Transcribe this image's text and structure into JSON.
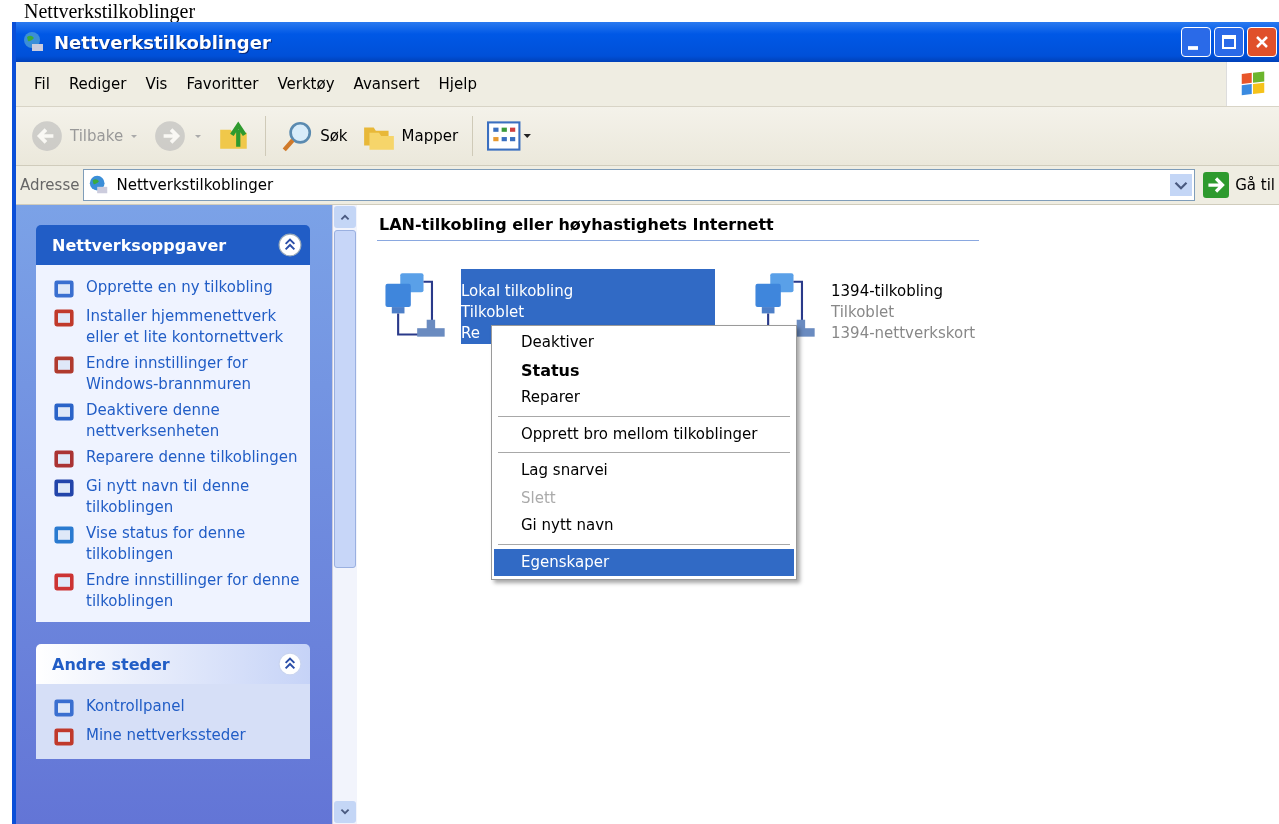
{
  "caption": "Nettverkstilkoblinger",
  "window": {
    "title": "Nettverkstilkoblinger"
  },
  "menu_bar": [
    "Fil",
    "Rediger",
    "Vis",
    "Favoritter",
    "Verktøy",
    "Avansert",
    "Hjelp"
  ],
  "toolbar": [
    {
      "kind": "back",
      "label": "Tilbake",
      "disabled": true
    },
    {
      "kind": "forward",
      "disabled": true
    },
    {
      "kind": "up",
      "disabled": false
    },
    {
      "kind": "search",
      "label": "Søk",
      "disabled": false
    },
    {
      "kind": "folders",
      "label": "Mapper",
      "disabled": false
    },
    {
      "kind": "views",
      "disabled": false
    }
  ],
  "address_bar": {
    "label": "Adresse",
    "value": "Nettverkstilkoblinger",
    "go_label": "Gå til"
  },
  "sidebar": {
    "sections": [
      {
        "title": "Nettverksoppgaver",
        "kind": "special",
        "expanded": true,
        "items": [
          "Opprette en ny tilkobling",
          "Installer hjemmenettverk eller et lite kontornettverk",
          "Endre innstillinger for Windows-brannmuren",
          "Deaktivere denne nettverksenheten",
          "Reparere denne tilkoblingen",
          "Gi nytt navn til denne tilkoblingen",
          "Vise status for denne tilkoblingen",
          "Endre innstillinger for denne tilkoblingen"
        ]
      },
      {
        "title": "Andre steder",
        "kind": "normal",
        "expanded": true,
        "items": [
          "Kontrollpanel",
          "Mine nettverkssteder"
        ]
      }
    ]
  },
  "group": {
    "title": "LAN-tilkobling eller høyhastighets Internett",
    "connections": [
      {
        "name": "Lokal tilkobling",
        "status": "Tilkoblet",
        "device": "Re",
        "selected": true
      },
      {
        "name": "1394-tilkobling",
        "status": "Tilkoblet",
        "device": "1394-nettverkskort",
        "selected": false
      }
    ]
  },
  "context_menu": {
    "groups": [
      {
        "items": [
          {
            "label": "Deaktiver",
            "default": false,
            "disabled": false,
            "selected": false
          },
          {
            "label": "Status",
            "default": true,
            "disabled": false,
            "selected": false
          },
          {
            "label": "Reparer",
            "default": false,
            "disabled": false,
            "selected": false
          }
        ]
      },
      {
        "items": [
          {
            "label": "Opprett bro mellom tilkoblinger",
            "default": false,
            "disabled": false,
            "selected": false
          }
        ]
      },
      {
        "items": [
          {
            "label": "Lag snarvei",
            "default": false,
            "disabled": false,
            "selected": false
          },
          {
            "label": "Slett",
            "default": false,
            "disabled": true,
            "selected": false
          },
          {
            "label": "Gi nytt navn",
            "default": false,
            "disabled": false,
            "selected": false
          }
        ]
      },
      {
        "items": [
          {
            "label": "Egenskaper",
            "default": false,
            "disabled": false,
            "selected": true
          }
        ]
      }
    ]
  }
}
